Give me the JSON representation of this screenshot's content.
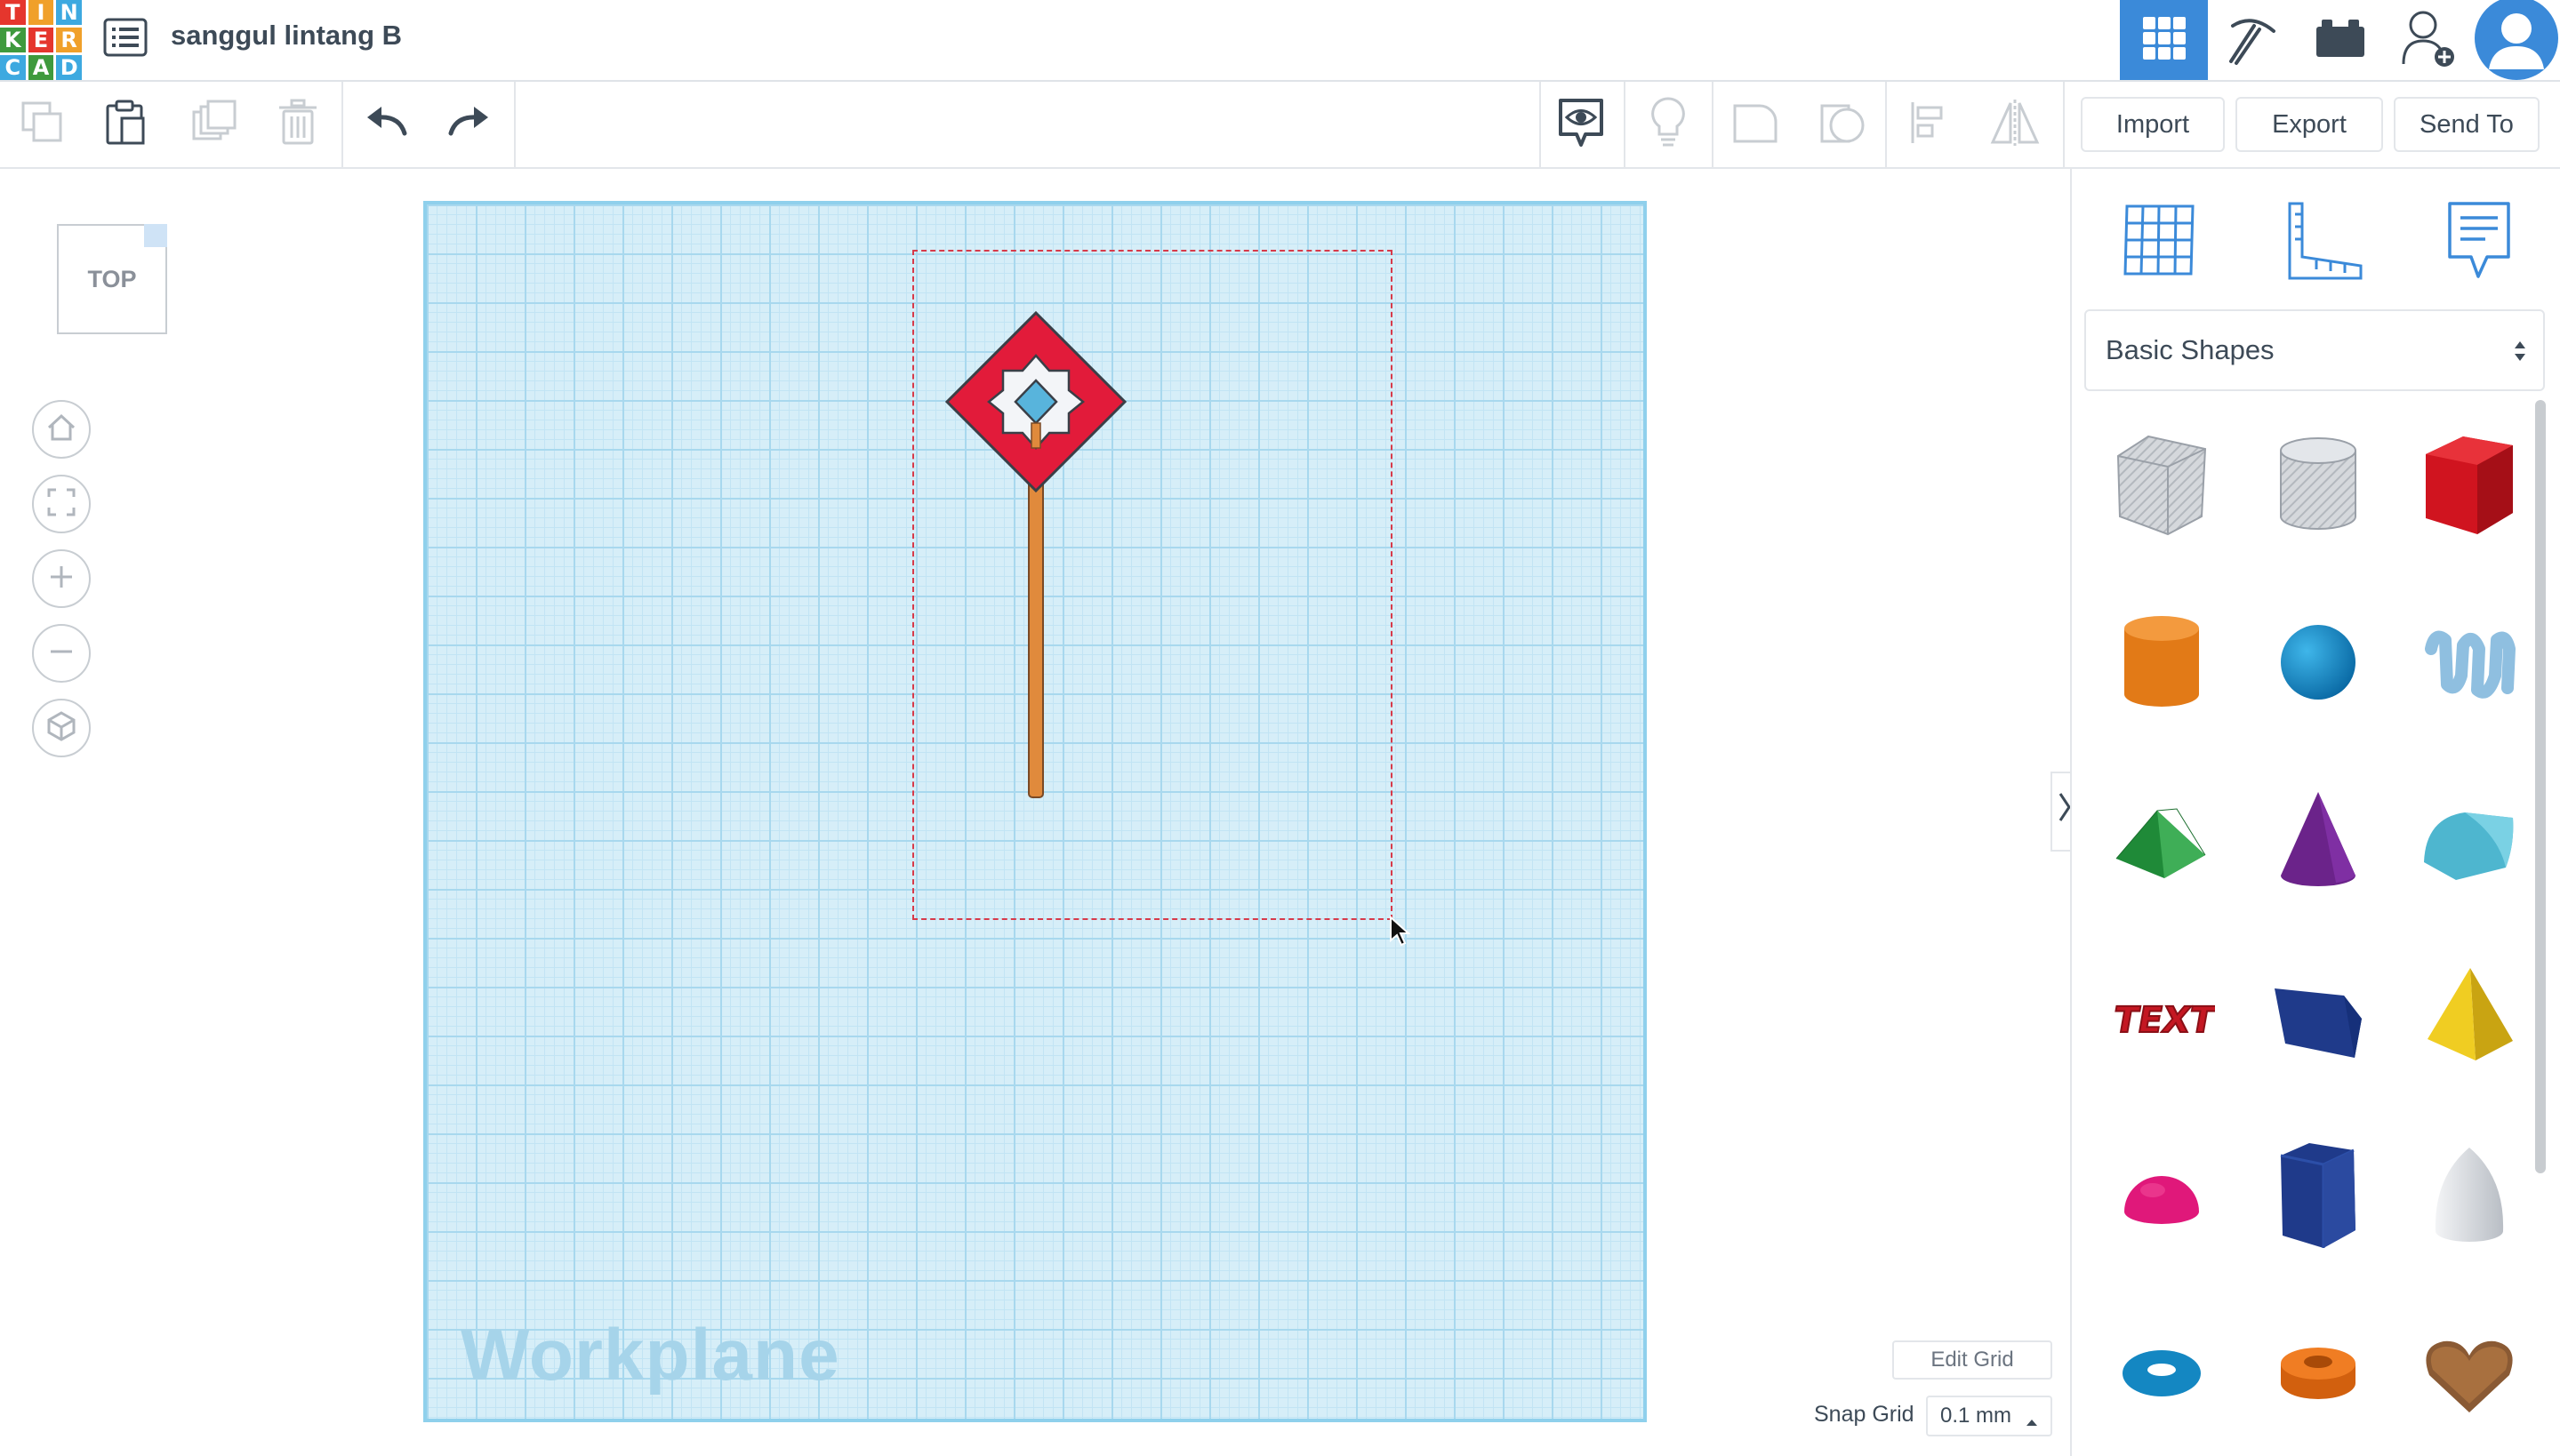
{
  "app": {
    "logo_letters": [
      "T",
      "I",
      "N",
      "K",
      "E",
      "R",
      "C",
      "A",
      "D"
    ],
    "logo_colors": [
      "#e5362d",
      "#f0a02a",
      "#3da9e0",
      "#3f9a3d",
      "#e5362d",
      "#f0a02a",
      "#3da9e0",
      "#3f9a3d",
      "#3da9e0"
    ],
    "title": "sanggul lintang B",
    "accent": "#3b8ad9"
  },
  "toolbar": {
    "import_label": "Import",
    "export_label": "Export",
    "send_to_label": "Send To"
  },
  "view": {
    "viewcube_label": "TOP"
  },
  "workplane": {
    "label": "Workplane",
    "edit_grid_label": "Edit Grid",
    "snap_grid_label": "Snap Grid",
    "snap_grid_value": "0.1 mm"
  },
  "shapes_panel": {
    "category": "Basic Shapes",
    "shapes": [
      "box-hole",
      "cylinder-hole",
      "box",
      "cylinder",
      "sphere",
      "scribble",
      "roof",
      "cone",
      "round-roof",
      "text",
      "wedge",
      "pyramid",
      "half-sphere",
      "polygon",
      "paraboloid",
      "torus",
      "tube",
      "heart"
    ]
  }
}
